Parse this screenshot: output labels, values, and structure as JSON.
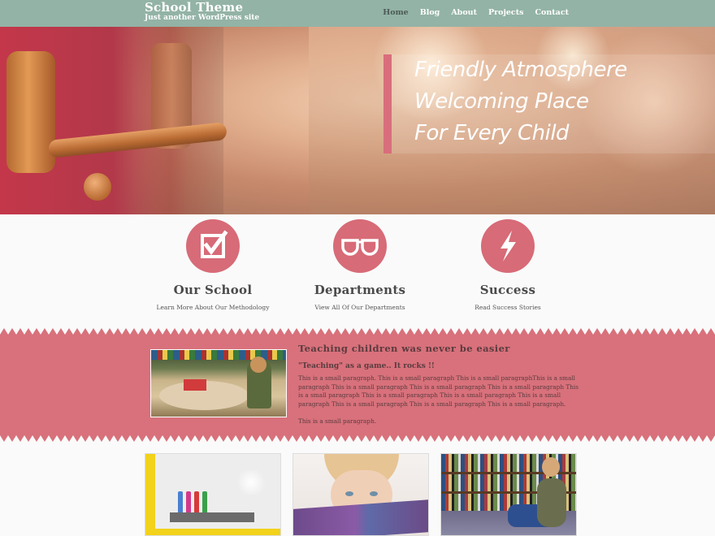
{
  "site": {
    "title": "School Theme",
    "tagline": "Just another WordPress site"
  },
  "nav": {
    "items": [
      {
        "label": "Home",
        "active": true
      },
      {
        "label": "Blog",
        "active": false
      },
      {
        "label": "About",
        "active": false
      },
      {
        "label": "Projects",
        "active": false
      },
      {
        "label": "Contact",
        "active": false
      }
    ]
  },
  "hero": {
    "slogan_lines": [
      "Friendly Atmosphere",
      "Welcoming Place",
      "For Every Child"
    ]
  },
  "features": [
    {
      "icon": "checkbox-icon",
      "title": "Our School",
      "description": "Learn More About Our Methodology"
    },
    {
      "icon": "glasses-icon",
      "title": "Departments",
      "description": "View All Of Our Departments"
    },
    {
      "icon": "lightning-icon",
      "title": "Success",
      "description": "Read Success Stories"
    }
  ],
  "band": {
    "title": "Teaching children was never be easier",
    "subtitle": "\"Teaching\" as a game.. It rocks !!",
    "paragraph": "This is a small paragraph. This is a small paragraph This is a small paragraphThis is a small paragraph This is a small paragraph This is a small paragraph This is a small paragraph This is a small paragraph This is a small paragraph This is a small paragraph This is a small paragraph This is a small paragraph This is a small paragraph This is a small paragraph.",
    "paragraph2": "This is a small paragraph."
  },
  "colors": {
    "header": "#93b3a6",
    "accent": "#d76b77",
    "band": "#d8717b"
  }
}
